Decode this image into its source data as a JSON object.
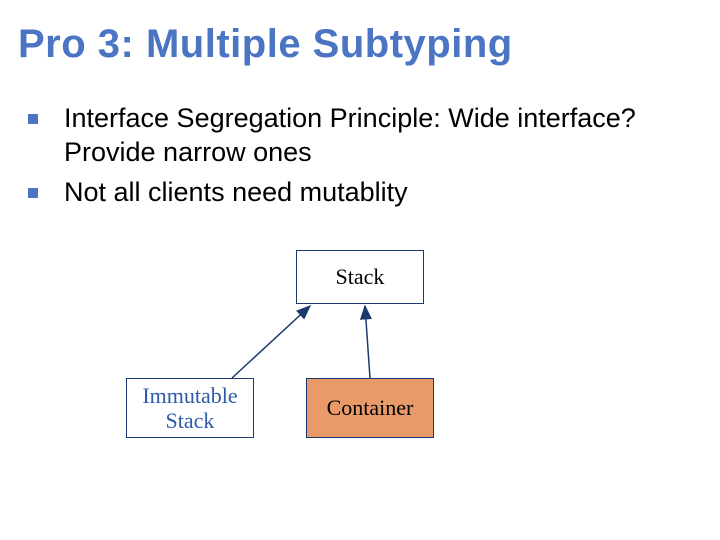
{
  "title": "Pro 3: Multiple Subtyping",
  "bullets": [
    "Interface Segregation Principle: Wide interface? Provide narrow ones",
    "Not all clients need mutablity"
  ],
  "diagram": {
    "parent": "Stack",
    "child_left": "Immutable Stack",
    "child_right": "Container"
  },
  "colors": {
    "title": "#4b74c2",
    "bullet": "#4b74c2",
    "box_border": "#1a3a6e",
    "container_fill": "#e89b68",
    "immutable_text": "#2f5aa8",
    "arrow": "#1a3a6e"
  }
}
